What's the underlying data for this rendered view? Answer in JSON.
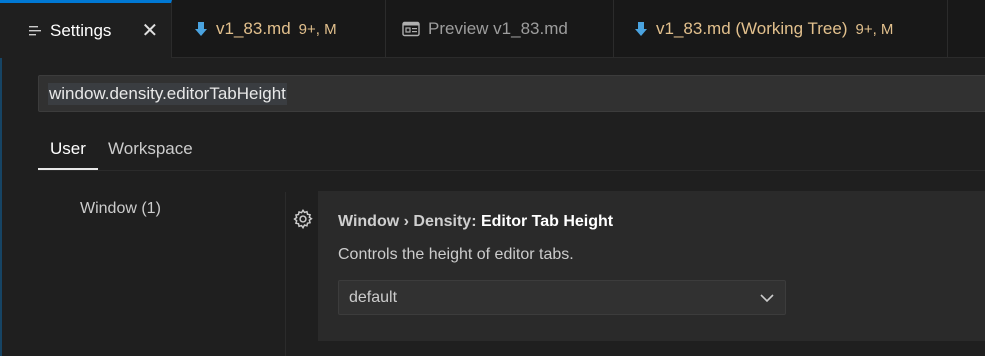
{
  "tabs": [
    {
      "label": "Settings",
      "icon": "settings-list-icon",
      "active": true
    },
    {
      "label": "v1_83.md",
      "meta": "9+, M",
      "icon": "markdown-down-arrow-icon"
    },
    {
      "label": "Preview v1_83.md",
      "icon": "preview-icon"
    },
    {
      "label": "v1_83.md (Working Tree)",
      "meta": "9+, M",
      "icon": "markdown-down-arrow-icon"
    }
  ],
  "search": {
    "value": "window.density.editorTabHeight"
  },
  "scopes": {
    "user": "User",
    "workspace": "Workspace"
  },
  "toc": {
    "item": "Window (1)"
  },
  "setting": {
    "category": "Window › Density: ",
    "name": "Editor Tab Height",
    "description": "Controls the height of editor tabs.",
    "value": "default"
  },
  "colors": {
    "accent": "#0078d4",
    "modified": "#e2c08d",
    "icon_blue": "#4aa3df"
  }
}
